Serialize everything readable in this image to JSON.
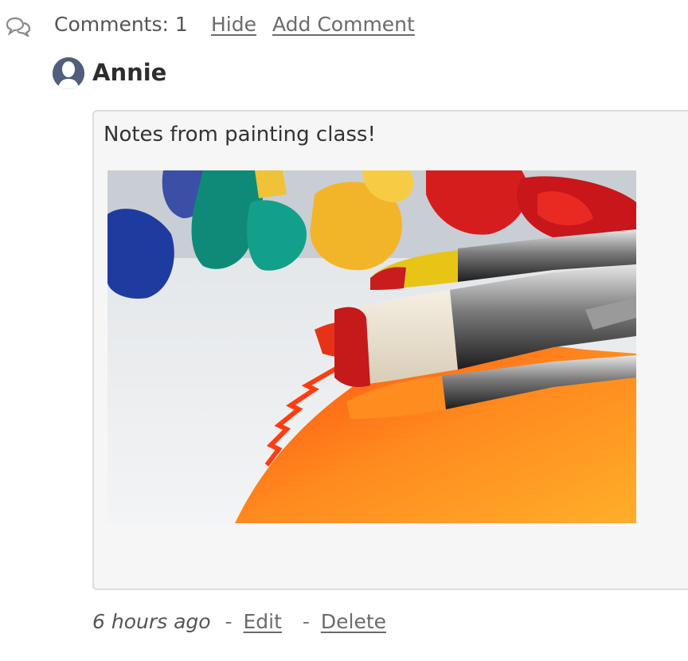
{
  "comments": {
    "count_label": "Comments: 1",
    "hide_label": "Hide",
    "add_label": "Add Comment"
  },
  "comment": {
    "author": "Annie",
    "text": "Notes from painting class!",
    "timestamp": "6 hours ago",
    "separator": "-",
    "edit_label": "Edit",
    "delete_label": "Delete",
    "image_alt": "Paint brushes with red, yellow and orange paint on white canvas, paint tubes in background"
  },
  "icons": {
    "chat": "chat-bubbles-icon",
    "avatar": "user-avatar-icon"
  },
  "colors": {
    "avatar": "#4f5f7d",
    "box_bg": "#f6f6f6",
    "link": "#6b6b6b"
  }
}
